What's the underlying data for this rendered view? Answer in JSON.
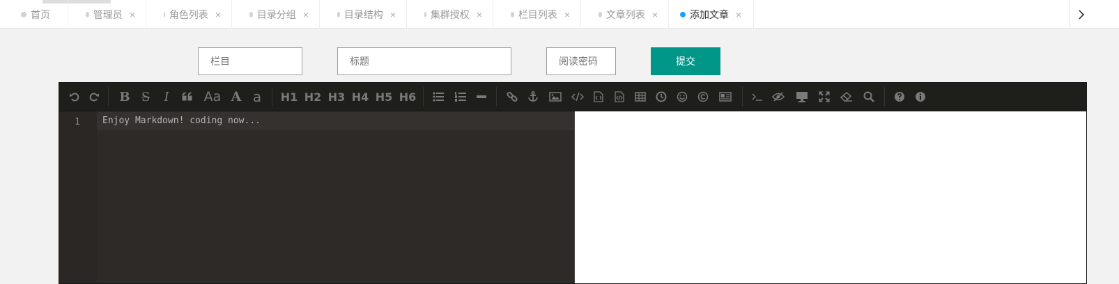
{
  "tabs": [
    {
      "label": "首页",
      "closable": false,
      "active": false
    },
    {
      "label": "管理员",
      "closable": true,
      "active": false
    },
    {
      "label": "角色列表",
      "closable": true,
      "active": false
    },
    {
      "label": "目录分组",
      "closable": true,
      "active": false
    },
    {
      "label": "目录结构",
      "closable": true,
      "active": false
    },
    {
      "label": "集群授权",
      "closable": true,
      "active": false
    },
    {
      "label": "栏目列表",
      "closable": true,
      "active": false
    },
    {
      "label": "文章列表",
      "closable": true,
      "active": false
    },
    {
      "label": "添加文章",
      "closable": true,
      "active": true
    }
  ],
  "tab_close_glyph": "×",
  "form": {
    "column_placeholder": "栏目",
    "title_placeholder": "标题",
    "password_placeholder": "阅读密码",
    "submit_label": "提交"
  },
  "toolbar": {
    "h1": "H1",
    "h2": "H2",
    "h3": "H3",
    "h4": "H4",
    "h5": "H5",
    "h6": "H6",
    "bold": "B",
    "strike": "S",
    "italic": "I",
    "case_mixed": "Aa",
    "case_upper": "A",
    "case_lower": "a"
  },
  "editor": {
    "line_numbers": [
      "1"
    ],
    "content": "Enjoy Markdown! coding now..."
  },
  "colors": {
    "accent": "#009688",
    "active_tab_dot": "#1e9fff",
    "toolbar_bg": "#1e1e1b",
    "editor_bg": "#2d2a28"
  }
}
